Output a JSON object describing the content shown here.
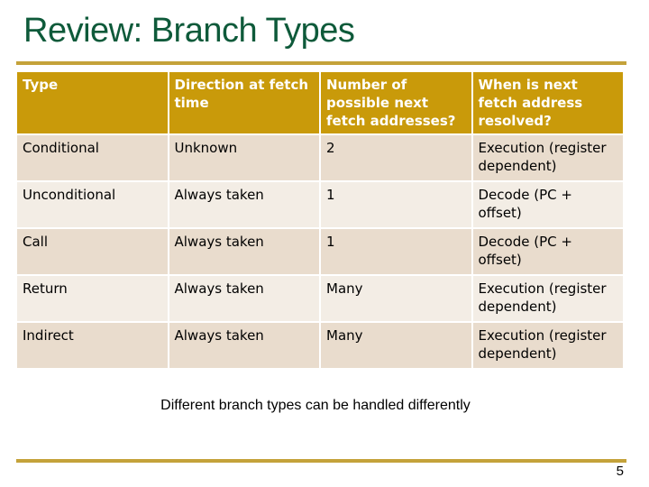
{
  "slide": {
    "title": "Review: Branch Types",
    "caption": "Different branch types can be handled differently",
    "page_number": "5"
  },
  "colors": {
    "title": "#0e5a3a",
    "rule": "#c4a23a",
    "header_bg": "#c99a0a",
    "row_dark": "#e9dccd",
    "row_light": "#f3ede5"
  },
  "table": {
    "headers": [
      "Type",
      "Direction at fetch time",
      "Number of possible next fetch addresses?",
      "When is next fetch address resolved?"
    ],
    "rows": [
      [
        "Conditional",
        "Unknown",
        "2",
        "Execution (register dependent)"
      ],
      [
        "Unconditional",
        "Always taken",
        "1",
        "Decode (PC + offset)"
      ],
      [
        "Call",
        "Always taken",
        "1",
        "Decode (PC + offset)"
      ],
      [
        "Return",
        "Always taken",
        "Many",
        "Execution (register dependent)"
      ],
      [
        "Indirect",
        "Always taken",
        "Many",
        "Execution (register dependent)"
      ]
    ]
  }
}
